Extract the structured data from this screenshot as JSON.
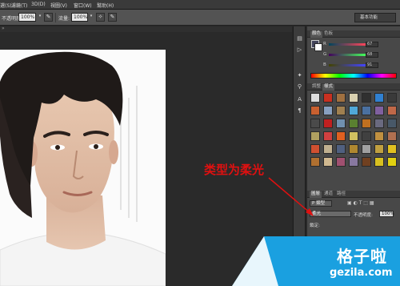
{
  "menubar": {
    "items": [
      "選(S)",
      "濾鏡(T)",
      "3D(D)",
      "視圖(V)",
      "窗口(W)",
      "幫助(H)"
    ]
  },
  "options": {
    "opacity_label": "不透明度:",
    "opacity_value": "100%",
    "flow_label": "流量:",
    "flow_value": "100%",
    "workspace": "基本功能"
  },
  "color_panel": {
    "tabs": [
      "顏色",
      "色板"
    ],
    "channels": [
      {
        "label": "R",
        "value": "67"
      },
      {
        "label": "G",
        "value": "68"
      },
      {
        "label": "B",
        "value": "91"
      }
    ]
  },
  "styles_panel": {
    "tabs": [
      "調整",
      "樣式"
    ],
    "swatch_colors": [
      "#dcdcdc",
      "#c83020",
      "#a07040",
      "#d8d0b0",
      "#303030",
      "#3080d0",
      "#3a3a3a",
      "#c86030",
      "#88a0c0",
      "#a08050",
      "#50a8d8",
      "#4a70a0",
      "#8060a0",
      "#c06848",
      "#4a4a4a",
      "#c02020",
      "#7090b0",
      "#5a8030",
      "#c07020",
      "#6a6a80",
      "#485868",
      "#b0a060",
      "#d04040",
      "#e06020",
      "#d0c060",
      "#404040",
      "#c09040",
      "#b07050",
      "#d05030",
      "#c0b090",
      "#506080",
      "#b08830",
      "#a0a0a0",
      "#c0a040",
      "#e0c020",
      "#b07030",
      "#d0b890",
      "#a05070",
      "#8878a0",
      "#704020",
      "#d8c020",
      "#e0d010"
    ]
  },
  "layers_panel": {
    "tabs": [
      "圖層",
      "通道",
      "路徑"
    ],
    "kind_label": "P 類型",
    "blend_mode": "柔光",
    "opacity_label": "不透明度:",
    "opacity_value": "100%",
    "lock_label": "鎖定:"
  },
  "annotation": {
    "text": "类型为柔光",
    "color": "#e01010"
  },
  "watermark": {
    "cn": "格子啦",
    "url": "gezila.com"
  }
}
